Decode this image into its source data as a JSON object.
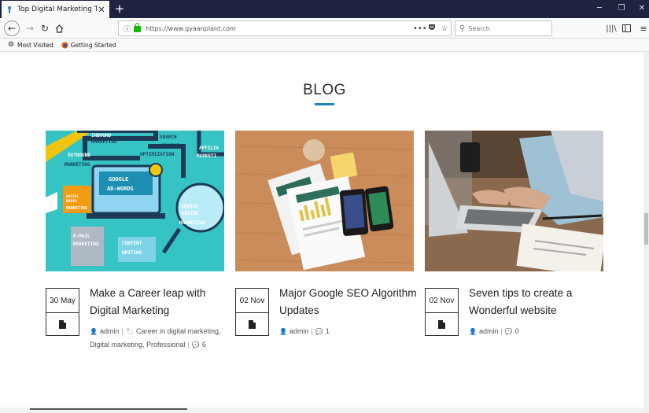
{
  "browser": {
    "tab_title": "Top Digital Marketing Training",
    "tab_close": "✕",
    "new_tab": "+",
    "window": {
      "minimize": "─",
      "restore": "❐",
      "close": "✕"
    },
    "url": "https://www.gyaanplant.com",
    "url_actions": {
      "more": "•••",
      "pocket": "pocket-icon",
      "bookmark": "☆"
    },
    "search_placeholder": "Search",
    "bookmarks": [
      {
        "label": "Most Visited",
        "icon": "gear-icon"
      },
      {
        "label": "Getting Started",
        "icon": "firefox-icon"
      }
    ]
  },
  "section": {
    "title": "BLOG",
    "accent_color": "#1b84c4"
  },
  "posts": [
    {
      "date": "30 May",
      "title": "Make a Career leap with Digital Marketing",
      "author": "admin",
      "categories": "Career in digital marketing, Digital marketing, Professional",
      "comments": "6",
      "image_texts": [
        "INBOUND MARKETING",
        "OUTBOUND MARKETING",
        "SEARCH ENGINE OPTIMIZATION",
        "AFFILIATE MARKETING",
        "GOOGLE AD-WORDS",
        "SOCIAL MEDIA MARKETING",
        "SEARCH ENGINE MARKETING",
        "E-MAIL MARKETING",
        "CONTENT WRITING"
      ]
    },
    {
      "date": "02 Nov",
      "title": "Major Google SEO Algorithm Updates",
      "author": "admin",
      "categories": "",
      "comments": "1"
    },
    {
      "date": "02 Nov",
      "title": "Seven tips to create a Wonderful website",
      "author": "admin",
      "categories": "",
      "comments": "0"
    }
  ]
}
